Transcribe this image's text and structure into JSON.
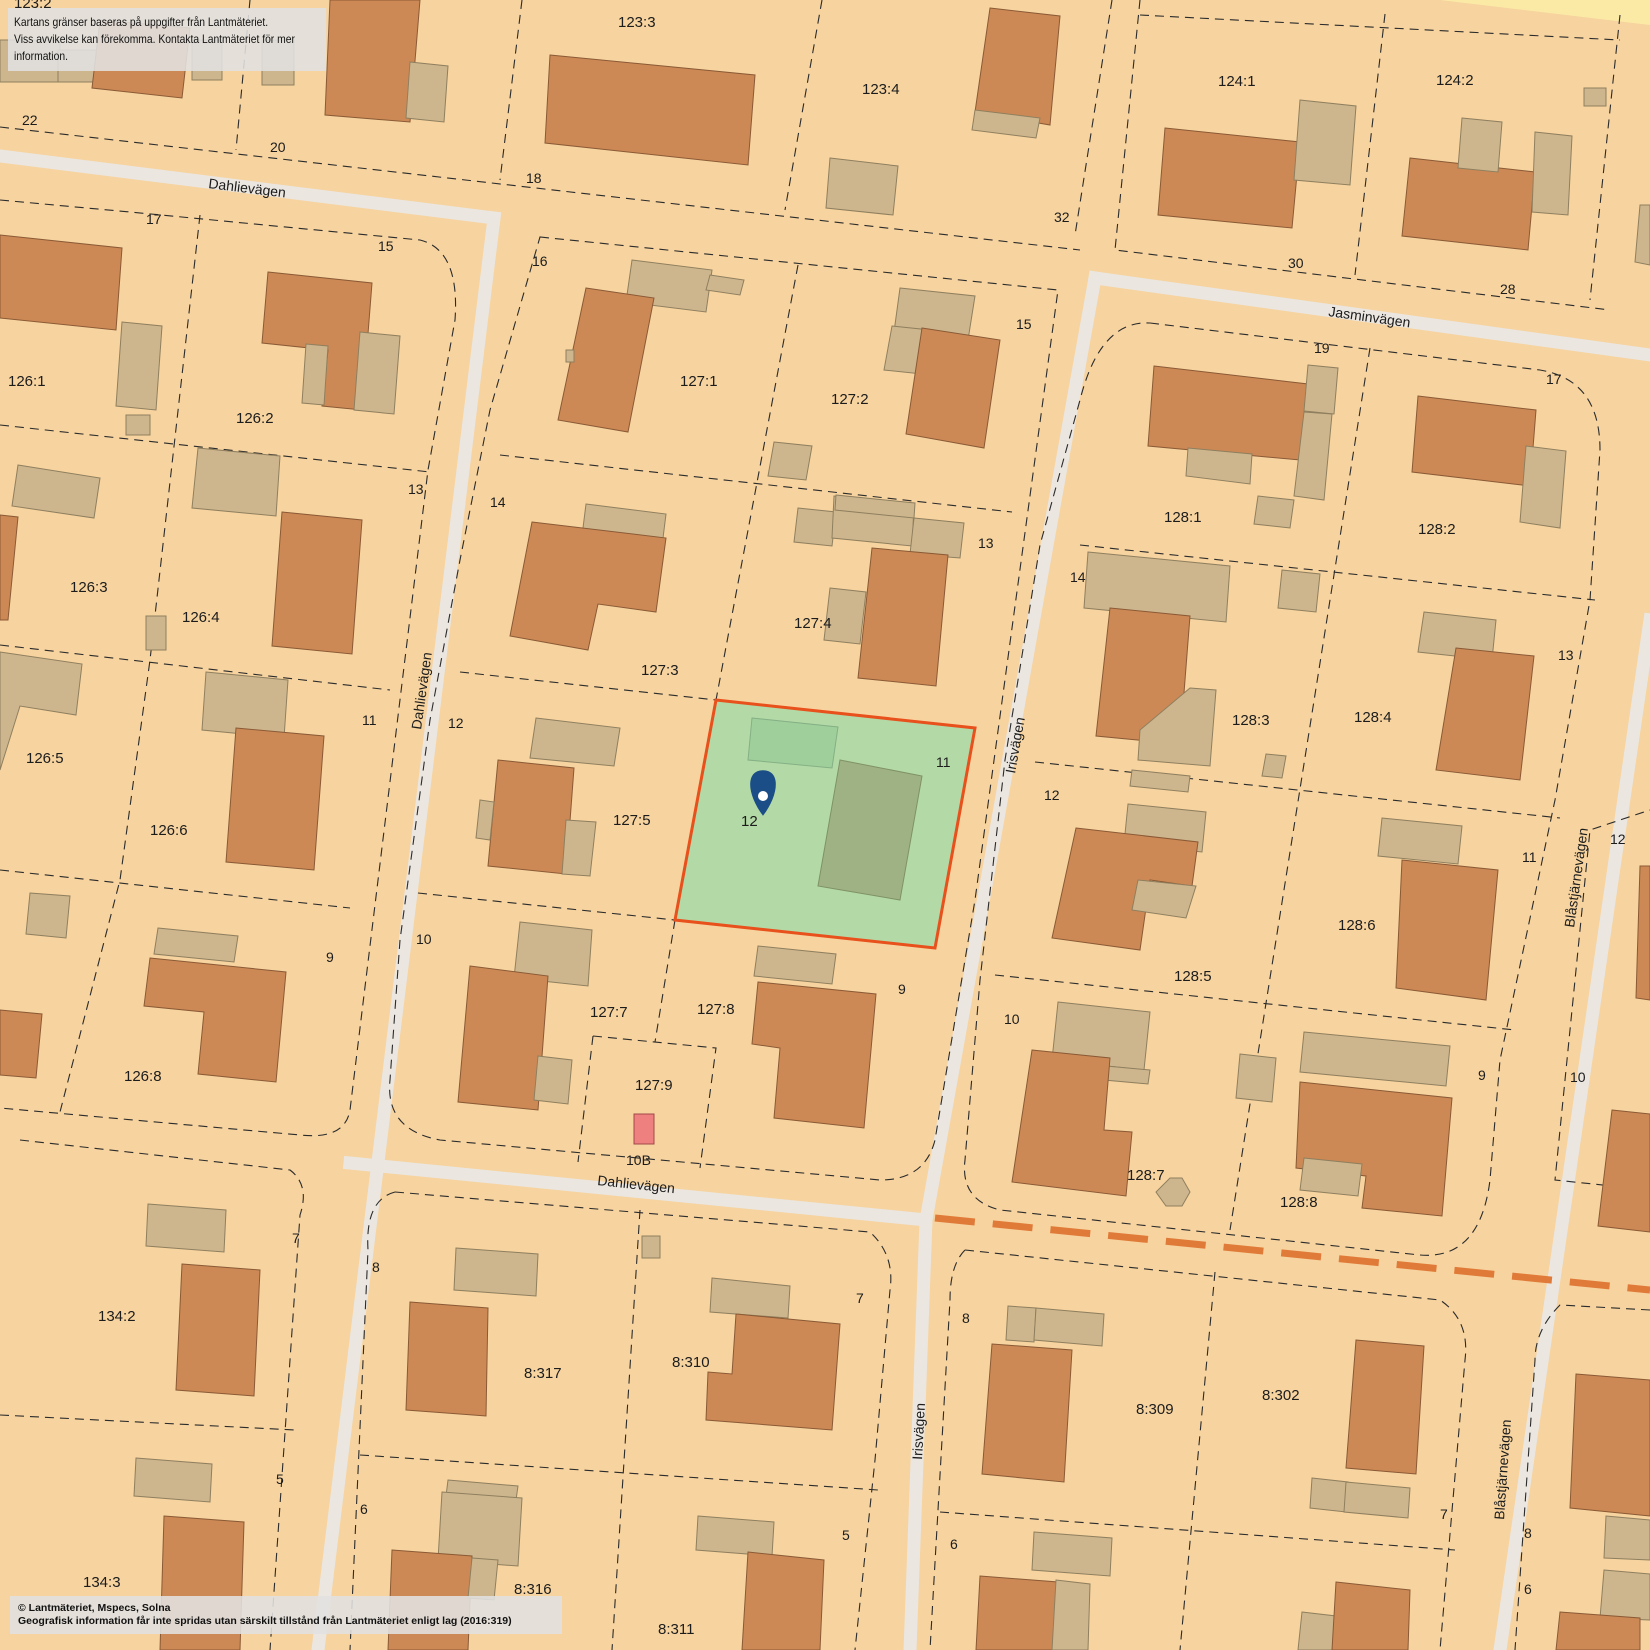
{
  "notices": {
    "top_line1": "Kartans gränser baseras på uppgifter från Lantmäteriet.",
    "top_line2": "Viss avvikelse kan förekomma. Kontakta Lantmäteriet för mer information.",
    "bottom_line1": "© Lantmäteriet, Mspecs, Solna",
    "bottom_line2": "Geografisk information får inte spridas utan särskilt tillstånd från Lantmäteriet enligt lag (2016:319)"
  },
  "streets": {
    "dahlie_top": "Dahlievägen",
    "dahlie_vertical": "Dahlievägen",
    "dahlie_bottom": "Dahlievägen",
    "jasmin": "Jasminvägen",
    "iris_mid": "Irisvägen",
    "iris_bottom": "Irisvägen",
    "blastjarne_mid": "Blåstjärnevägen",
    "blastjarne_bottom": "Blåstjärnevägen"
  },
  "parcels": {
    "p123_2": "123:2",
    "p123_3": "123:3",
    "p123_4": "123:4",
    "p124_1": "124:1",
    "p124_2": "124:2",
    "p126_1": "126:1",
    "p126_2": "126:2",
    "p126_3": "126:3",
    "p126_4": "126:4",
    "p126_5": "126:5",
    "p126_6": "126:6",
    "p126_8": "126:8",
    "p127_1": "127:1",
    "p127_2": "127:2",
    "p127_3": "127:3",
    "p127_4": "127:4",
    "p127_5": "127:5",
    "p127_6": "12",
    "p127_7": "127:7",
    "p127_8": "127:8",
    "p127_9": "127:9",
    "p128_1": "128:1",
    "p128_2": "128:2",
    "p128_3": "128:3",
    "p128_4": "128:4",
    "p128_5": "128:5",
    "p128_6": "128:6",
    "p128_7": "128:7",
    "p128_8": "128:8",
    "p134_2": "134:2",
    "p134_3": "134:3",
    "p8_317": "8:317",
    "p8_310": "8:310",
    "p8_309": "8:309",
    "p8_302": "8:302",
    "p8_316": "8:316",
    "p8_311": "8:311"
  },
  "addresses": {
    "a22": "22",
    "a20": "20",
    "a18": "18",
    "a32": "32",
    "a30": "30",
    "a28": "28",
    "a17l": "17",
    "a15l": "15",
    "a16": "16",
    "a15m": "15",
    "a19": "19",
    "a17r": "17",
    "a14m": "14",
    "a13l": "13",
    "a13m": "13",
    "a14r": "14",
    "a13r": "13",
    "a11l": "11",
    "a12m": "12",
    "a11m": "11",
    "a12r": "12",
    "a11r": "11",
    "a12rr": "12",
    "a9l": "9",
    "a10m": "10",
    "a9m": "9",
    "a10r": "10",
    "a9r": "9",
    "a10rr": "10",
    "a10b": "10B",
    "a7l": "7",
    "a8m": "8",
    "a7m": "7",
    "a8r": "8",
    "a7r": "7",
    "a5l": "5",
    "a6m": "6",
    "a5m": "5",
    "a6r": "6",
    "a8rr": "8",
    "a6rr": "6"
  },
  "marker": {
    "icon": "location-pin-icon",
    "color": "#1b4d86"
  },
  "colors": {
    "highlight_fill": "#b3d9a6",
    "highlight_border": "#e8501c",
    "boundary_dash": "#e07a38"
  }
}
